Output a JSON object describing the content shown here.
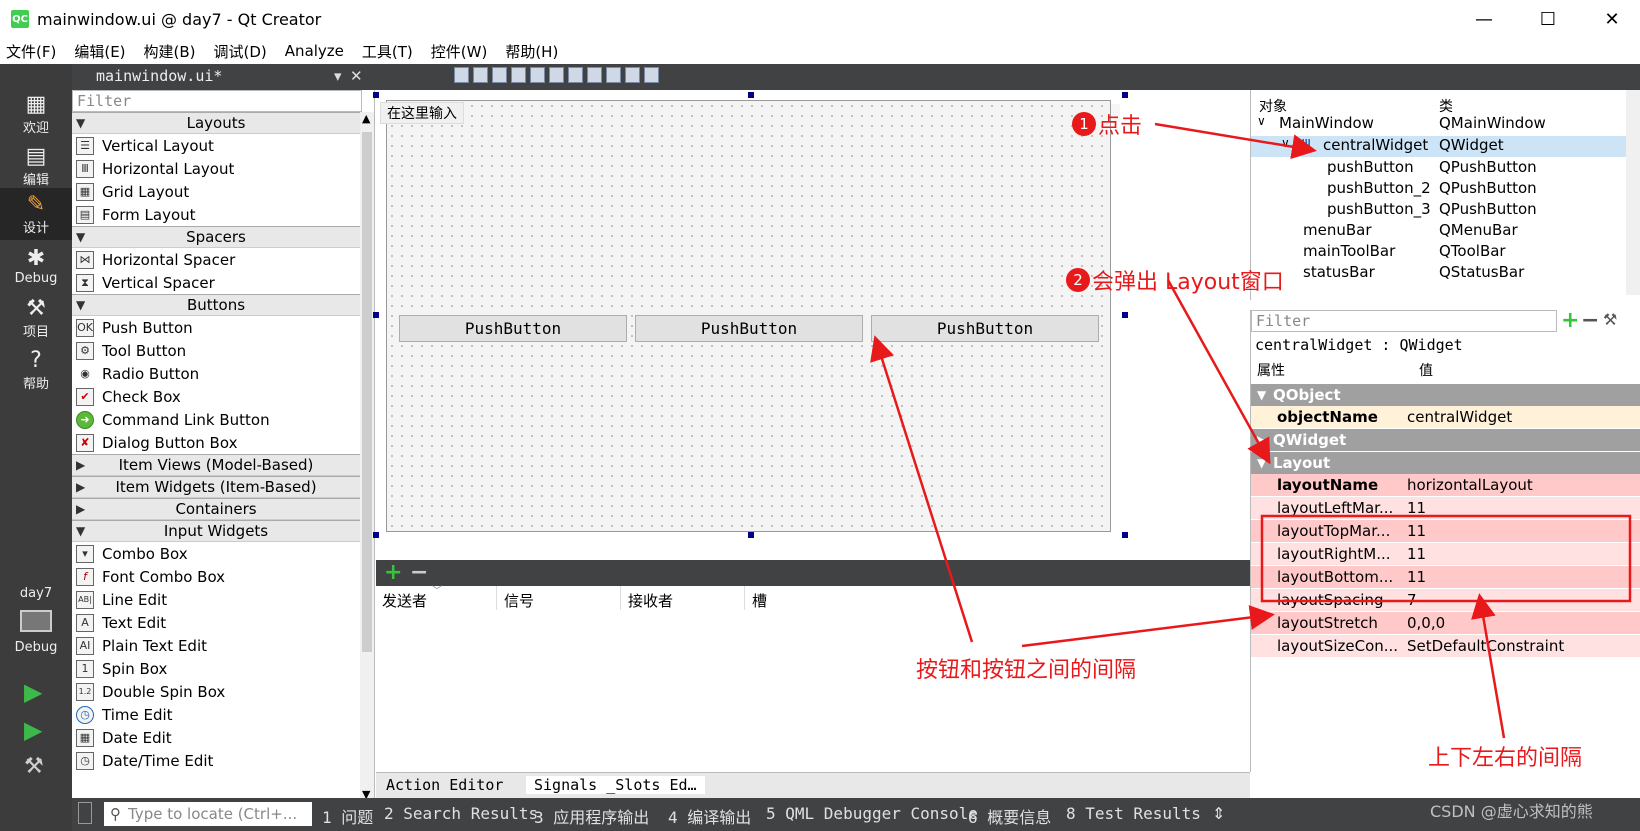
{
  "window": {
    "title": "mainwindow.ui @ day7 - Qt Creator",
    "logo": "QC",
    "minimize": "—",
    "maximize": "☐",
    "close": "✕"
  },
  "menu": [
    "文件(F)",
    "编辑(E)",
    "构建(B)",
    "调试(D)",
    "Analyze",
    "工具(T)",
    "控件(W)",
    "帮助(H)"
  ],
  "modes": [
    {
      "label": "欢迎",
      "icon": "grid-icon"
    },
    {
      "label": "编辑",
      "icon": "document-icon"
    },
    {
      "label": "设计",
      "icon": "pencil-icon"
    },
    {
      "label": "Debug",
      "icon": "bug-icon"
    },
    {
      "label": "项目",
      "icon": "wrench-icon"
    },
    {
      "label": "帮助",
      "icon": "help-icon"
    }
  ],
  "kit": {
    "project": "day7",
    "label": "Debug"
  },
  "doc": {
    "file": "mainwindow.ui*",
    "close": "✕"
  },
  "widgetbox": {
    "filter": "Filter",
    "categories": {
      "layouts": "Layouts",
      "spacers": "Spacers",
      "buttons": "Buttons",
      "itemviews": "Item Views (Model-Based)",
      "itemwidgets": "Item Widgets (Item-Based)",
      "containers": "Containers",
      "input": "Input Widgets"
    },
    "layouts": [
      "Vertical Layout",
      "Horizontal Layout",
      "Grid Layout",
      "Form Layout"
    ],
    "spacers": [
      "Horizontal Spacer",
      "Vertical Spacer"
    ],
    "buttons": [
      "Push Button",
      "Tool Button",
      "Radio Button",
      "Check Box",
      "Command Link Button",
      "Dialog Button Box"
    ],
    "input": [
      "Combo Box",
      "Font Combo Box",
      "Line Edit",
      "Text Edit",
      "Plain Text Edit",
      "Spin Box",
      "Double Spin Box",
      "Time Edit",
      "Date Edit",
      "Date/Time Edit"
    ]
  },
  "form": {
    "menu_placeholder": "在这里输入",
    "buttons": [
      "PushButton",
      "PushButton",
      "PushButton"
    ]
  },
  "signals": {
    "headers": [
      "发送者",
      "信号",
      "接收者",
      "槽"
    ],
    "tabs": [
      "Action Editor",
      "Signals _Slots Ed…"
    ]
  },
  "objects": {
    "headers": [
      "对象",
      "类"
    ],
    "rows": [
      {
        "name": "MainWindow",
        "cls": "QMainWindow"
      },
      {
        "name": "centralWidget",
        "cls": "QWidget"
      },
      {
        "name": "pushButton",
        "cls": "QPushButton"
      },
      {
        "name": "pushButton_2",
        "cls": "QPushButton"
      },
      {
        "name": "pushButton_3",
        "cls": "QPushButton"
      },
      {
        "name": "menuBar",
        "cls": "QMenuBar"
      },
      {
        "name": "mainToolBar",
        "cls": "QToolBar"
      },
      {
        "name": "statusBar",
        "cls": "QStatusBar"
      }
    ]
  },
  "properties": {
    "filter": "Filter",
    "class_line": "centralWidget : QWidget",
    "headers": [
      "属性",
      "值"
    ],
    "groups": [
      "QObject",
      "QWidget",
      "Layout"
    ],
    "objectName": {
      "name": "objectName",
      "value": "centralWidget"
    },
    "layout": [
      {
        "name": "layoutName",
        "value": "horizontalLayout"
      },
      {
        "name": "layoutLeftMar...",
        "value": "11"
      },
      {
        "name": "layoutTopMar...",
        "value": "11"
      },
      {
        "name": "layoutRightM...",
        "value": "11"
      },
      {
        "name": "layoutBottom...",
        "value": "11"
      },
      {
        "name": "layoutSpacing",
        "value": "7"
      },
      {
        "name": "layoutStretch",
        "value": "0,0,0"
      },
      {
        "name": "layoutSizeCon...",
        "value": "SetDefaultConstraint"
      }
    ]
  },
  "statusbar": {
    "locator": "Type to locate (Ctrl+...",
    "items": [
      "1 问题",
      "2 Search Results",
      "3 应用程序输出",
      "4 编译输出",
      "5 QML Debugger Console",
      "6 概要信息",
      "8 Test Results"
    ]
  },
  "annotations": {
    "step1": {
      "num": "1",
      "text": "点击"
    },
    "step2": {
      "num": "2",
      "text": "会弹出 Layout窗口"
    },
    "spacing": "按钮和按钮之间的间隔",
    "margins": "上下左右的间隔",
    "accent": "#e8191b"
  },
  "watermark": "CSDN @虚心求知的熊"
}
